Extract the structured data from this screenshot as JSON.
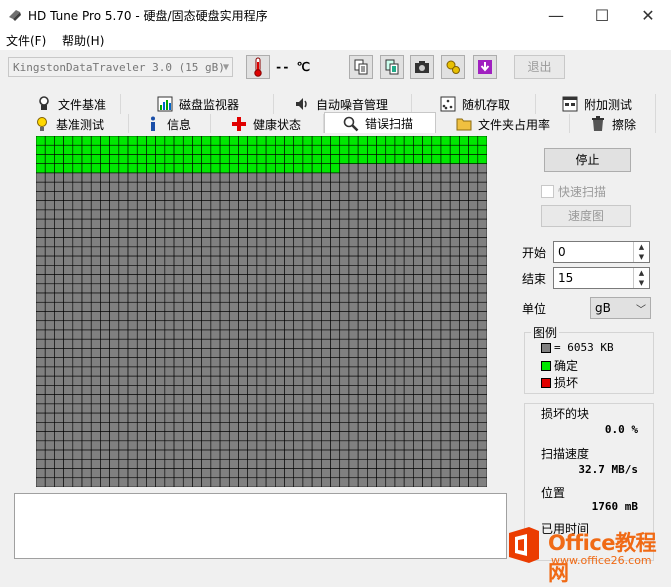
{
  "window": {
    "title": "HD Tune Pro 5.70 - 硬盘/固态硬盘实用程序",
    "minimize_glyph": "—",
    "maximize_glyph": "☐",
    "close_glyph": "✕"
  },
  "menu": {
    "file": "文件(F)",
    "help": "帮助(H)"
  },
  "toolbar": {
    "drive": "KingstonDataTraveler 3.0 (15 gB)",
    "temperature": "-- ℃",
    "exit": "退出",
    "icons": [
      "copy-icon",
      "copy-all-icon",
      "camera-icon",
      "options-icon",
      "save-icon"
    ]
  },
  "tabs": {
    "row1": [
      "文件基准",
      "磁盘监视器",
      "自动噪音管理",
      "随机存取",
      "附加测试"
    ],
    "row2": [
      "基准测试",
      "信息",
      "健康状态",
      "错误扫描",
      "文件夹占用率",
      "擦除"
    ],
    "active": "错误扫描"
  },
  "scan": {
    "stop_button": "停止",
    "quick_scan": "快速扫描",
    "speed_map": "速度图",
    "start_label": "开始",
    "start_value": "0",
    "end_label": "结束",
    "end_value": "15",
    "unit_label": "单位",
    "unit_value": "gB",
    "legend_title": "图例",
    "legend_block": "= 6053 KB",
    "legend_ok": "确定",
    "legend_bad": "损坏",
    "damaged_label": "损坏的块",
    "damaged_value": "0.0 %",
    "speed_label": "扫描速度",
    "speed_value": "32.7 MB/s",
    "position_label": "位置",
    "position_value": "1760 mB",
    "elapsed_label": "已用时间"
  },
  "block_grid": {
    "columns": 49,
    "rows": 38,
    "scanned_full_rows": 3,
    "scanned_partial_columns": 33,
    "colors": {
      "ok": "#00e800",
      "pending": "#808080",
      "bad": "#e00000",
      "line": "#000000"
    }
  },
  "watermark": {
    "title": "Office教程网",
    "url": "www.office26.com"
  }
}
